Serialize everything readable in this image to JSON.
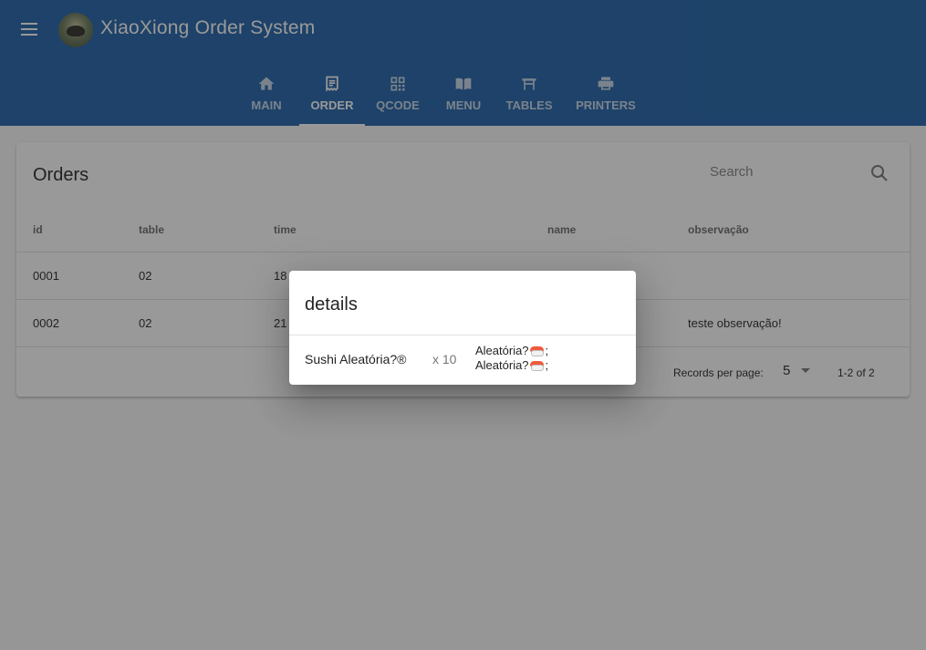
{
  "app": {
    "title": "XiaoXiong Order System"
  },
  "tabs": [
    {
      "label": "MAIN",
      "icon": "home-icon",
      "active": false
    },
    {
      "label": "ORDER",
      "icon": "receipt-icon",
      "active": true
    },
    {
      "label": "QCODE",
      "icon": "qr-code-icon",
      "active": false
    },
    {
      "label": "MENU",
      "icon": "menu-book-icon",
      "active": false
    },
    {
      "label": "TABLES",
      "icon": "table-icon",
      "active": false
    },
    {
      "label": "PRINTERS",
      "icon": "printer-icon",
      "active": false
    }
  ],
  "orders": {
    "title": "Orders",
    "search_placeholder": "Search",
    "columns": [
      "id",
      "table",
      "time",
      "name",
      "observação"
    ],
    "rows": [
      {
        "id": "0001",
        "table": "02",
        "time": "18",
        "name": "",
        "obs": ""
      },
      {
        "id": "0002",
        "table": "02",
        "time": "21",
        "name": "",
        "obs": "teste observação!"
      }
    ],
    "footer": {
      "rows_per_page_label": "Records per page:",
      "rows_per_page_value": "5",
      "range": "1-2 of 2"
    }
  },
  "dialog": {
    "title": "details",
    "item": "Sushi Aleatória?®",
    "qty": "x 10",
    "obs_lines": [
      "Aleatória?",
      "Aleatória?"
    ],
    "obs_suffix": ";"
  },
  "colors": {
    "appbar": "#1c5fa6",
    "scrim": "#212121"
  }
}
